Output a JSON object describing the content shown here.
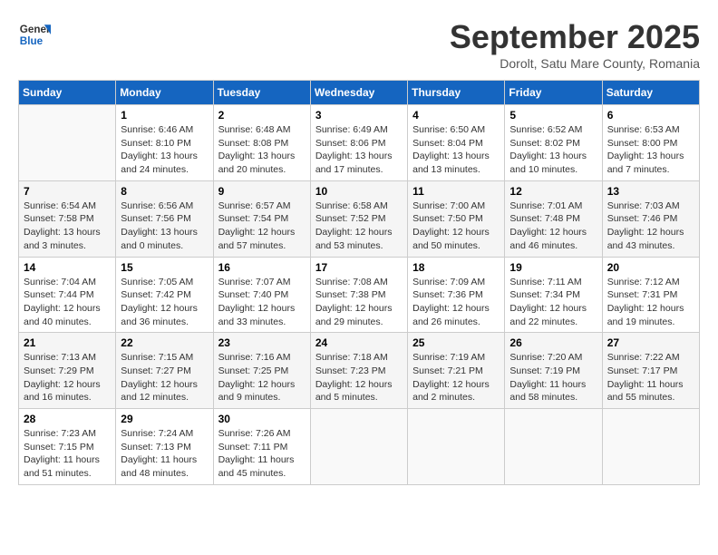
{
  "header": {
    "logo_line1": "General",
    "logo_line2": "Blue",
    "month_title": "September 2025",
    "subtitle": "Dorolt, Satu Mare County, Romania"
  },
  "days_of_week": [
    "Sunday",
    "Monday",
    "Tuesday",
    "Wednesday",
    "Thursday",
    "Friday",
    "Saturday"
  ],
  "weeks": [
    [
      {
        "day": "",
        "info": ""
      },
      {
        "day": "1",
        "info": "Sunrise: 6:46 AM\nSunset: 8:10 PM\nDaylight: 13 hours\nand 24 minutes."
      },
      {
        "day": "2",
        "info": "Sunrise: 6:48 AM\nSunset: 8:08 PM\nDaylight: 13 hours\nand 20 minutes."
      },
      {
        "day": "3",
        "info": "Sunrise: 6:49 AM\nSunset: 8:06 PM\nDaylight: 13 hours\nand 17 minutes."
      },
      {
        "day": "4",
        "info": "Sunrise: 6:50 AM\nSunset: 8:04 PM\nDaylight: 13 hours\nand 13 minutes."
      },
      {
        "day": "5",
        "info": "Sunrise: 6:52 AM\nSunset: 8:02 PM\nDaylight: 13 hours\nand 10 minutes."
      },
      {
        "day": "6",
        "info": "Sunrise: 6:53 AM\nSunset: 8:00 PM\nDaylight: 13 hours\nand 7 minutes."
      }
    ],
    [
      {
        "day": "7",
        "info": "Sunrise: 6:54 AM\nSunset: 7:58 PM\nDaylight: 13 hours\nand 3 minutes."
      },
      {
        "day": "8",
        "info": "Sunrise: 6:56 AM\nSunset: 7:56 PM\nDaylight: 13 hours\nand 0 minutes."
      },
      {
        "day": "9",
        "info": "Sunrise: 6:57 AM\nSunset: 7:54 PM\nDaylight: 12 hours\nand 57 minutes."
      },
      {
        "day": "10",
        "info": "Sunrise: 6:58 AM\nSunset: 7:52 PM\nDaylight: 12 hours\nand 53 minutes."
      },
      {
        "day": "11",
        "info": "Sunrise: 7:00 AM\nSunset: 7:50 PM\nDaylight: 12 hours\nand 50 minutes."
      },
      {
        "day": "12",
        "info": "Sunrise: 7:01 AM\nSunset: 7:48 PM\nDaylight: 12 hours\nand 46 minutes."
      },
      {
        "day": "13",
        "info": "Sunrise: 7:03 AM\nSunset: 7:46 PM\nDaylight: 12 hours\nand 43 minutes."
      }
    ],
    [
      {
        "day": "14",
        "info": "Sunrise: 7:04 AM\nSunset: 7:44 PM\nDaylight: 12 hours\nand 40 minutes."
      },
      {
        "day": "15",
        "info": "Sunrise: 7:05 AM\nSunset: 7:42 PM\nDaylight: 12 hours\nand 36 minutes."
      },
      {
        "day": "16",
        "info": "Sunrise: 7:07 AM\nSunset: 7:40 PM\nDaylight: 12 hours\nand 33 minutes."
      },
      {
        "day": "17",
        "info": "Sunrise: 7:08 AM\nSunset: 7:38 PM\nDaylight: 12 hours\nand 29 minutes."
      },
      {
        "day": "18",
        "info": "Sunrise: 7:09 AM\nSunset: 7:36 PM\nDaylight: 12 hours\nand 26 minutes."
      },
      {
        "day": "19",
        "info": "Sunrise: 7:11 AM\nSunset: 7:34 PM\nDaylight: 12 hours\nand 22 minutes."
      },
      {
        "day": "20",
        "info": "Sunrise: 7:12 AM\nSunset: 7:31 PM\nDaylight: 12 hours\nand 19 minutes."
      }
    ],
    [
      {
        "day": "21",
        "info": "Sunrise: 7:13 AM\nSunset: 7:29 PM\nDaylight: 12 hours\nand 16 minutes."
      },
      {
        "day": "22",
        "info": "Sunrise: 7:15 AM\nSunset: 7:27 PM\nDaylight: 12 hours\nand 12 minutes."
      },
      {
        "day": "23",
        "info": "Sunrise: 7:16 AM\nSunset: 7:25 PM\nDaylight: 12 hours\nand 9 minutes."
      },
      {
        "day": "24",
        "info": "Sunrise: 7:18 AM\nSunset: 7:23 PM\nDaylight: 12 hours\nand 5 minutes."
      },
      {
        "day": "25",
        "info": "Sunrise: 7:19 AM\nSunset: 7:21 PM\nDaylight: 12 hours\nand 2 minutes."
      },
      {
        "day": "26",
        "info": "Sunrise: 7:20 AM\nSunset: 7:19 PM\nDaylight: 11 hours\nand 58 minutes."
      },
      {
        "day": "27",
        "info": "Sunrise: 7:22 AM\nSunset: 7:17 PM\nDaylight: 11 hours\nand 55 minutes."
      }
    ],
    [
      {
        "day": "28",
        "info": "Sunrise: 7:23 AM\nSunset: 7:15 PM\nDaylight: 11 hours\nand 51 minutes."
      },
      {
        "day": "29",
        "info": "Sunrise: 7:24 AM\nSunset: 7:13 PM\nDaylight: 11 hours\nand 48 minutes."
      },
      {
        "day": "30",
        "info": "Sunrise: 7:26 AM\nSunset: 7:11 PM\nDaylight: 11 hours\nand 45 minutes."
      },
      {
        "day": "",
        "info": ""
      },
      {
        "day": "",
        "info": ""
      },
      {
        "day": "",
        "info": ""
      },
      {
        "day": "",
        "info": ""
      }
    ]
  ]
}
